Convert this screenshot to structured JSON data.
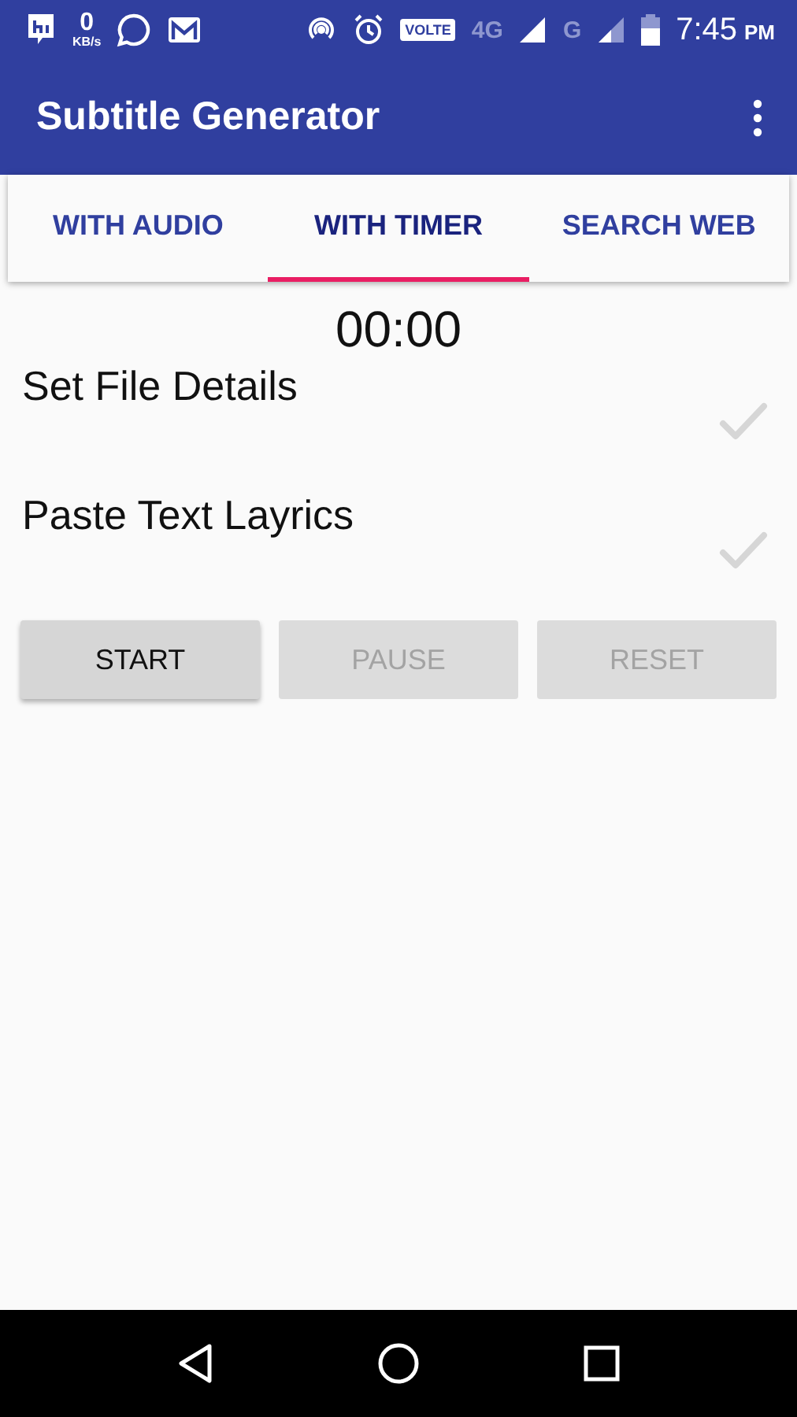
{
  "status_bar": {
    "speed_value": "0",
    "speed_unit": "KB/s",
    "volte": "VOLTE",
    "network_1": "4G",
    "network_2": "G",
    "time": "7:45",
    "meridiem": "PM"
  },
  "app_bar": {
    "title": "Subtitle Generator"
  },
  "tabs": [
    {
      "label": "WITH AUDIO",
      "selected": false
    },
    {
      "label": "WITH TIMER",
      "selected": true
    },
    {
      "label": "SEARCH WEB",
      "selected": false
    }
  ],
  "timer": "00:00",
  "steps": [
    {
      "label": "Set File Details",
      "checked": false
    },
    {
      "label": "Paste Text Layrics",
      "checked": false
    }
  ],
  "buttons": [
    {
      "label": "START",
      "disabled": false
    },
    {
      "label": "PAUSE",
      "disabled": true
    },
    {
      "label": "RESET",
      "disabled": true
    }
  ]
}
